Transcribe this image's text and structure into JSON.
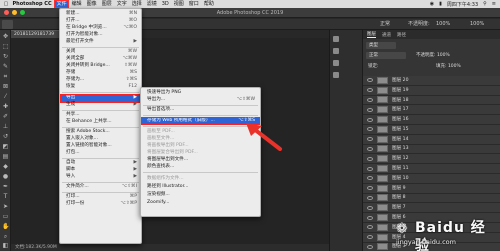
{
  "menubar": {
    "apple": "",
    "app": "Photoshop CC",
    "items": [
      "文件",
      "编辑",
      "图像",
      "图层",
      "文字",
      "选择",
      "滤镜",
      "3D",
      "视图",
      "窗口",
      "帮助"
    ],
    "active_index": 1,
    "clock": "周四下午4:33"
  },
  "titlebar": {
    "title": "Adobe Photoshop CC 2019"
  },
  "options": {
    "mode": "正常",
    "opacity_label": "不透明度:",
    "opacity": "100%",
    "zoom": "100%"
  },
  "document": {
    "tab_label": "20181129181739",
    "status": "文档:182.3K/5.90M"
  },
  "file_menu": {
    "items": [
      {
        "label": "新建...",
        "shortcut": "⌘N"
      },
      {
        "label": "打开...",
        "shortcut": "⌘O"
      },
      {
        "label": "在 Bridge 中浏览...",
        "shortcut": "⌥⌘O"
      },
      {
        "label": "打开为智能对象...",
        "shortcut": ""
      },
      {
        "label": "最近打开文件",
        "shortcut": "▶"
      },
      {
        "label": "关闭",
        "shortcut": "⌘W"
      },
      {
        "label": "关闭全部",
        "shortcut": "⌥⌘W"
      },
      {
        "label": "关闭并转到 Bridge...",
        "shortcut": "⇧⌘W"
      },
      {
        "label": "存储",
        "shortcut": "⌘S"
      },
      {
        "label": "存储为...",
        "shortcut": "⇧⌘S"
      },
      {
        "label": "恢复",
        "shortcut": "F12"
      },
      {
        "label": "导出",
        "shortcut": "▶"
      },
      {
        "label": "生成",
        "shortcut": "▶"
      },
      {
        "label": "共享...",
        "shortcut": ""
      },
      {
        "label": "在 Behance 上共享...",
        "shortcut": ""
      },
      {
        "label": "搜索 Adobe Stock...",
        "shortcut": ""
      },
      {
        "label": "置入嵌入对象...",
        "shortcut": ""
      },
      {
        "label": "置入链接的智能对象...",
        "shortcut": ""
      },
      {
        "label": "打包...",
        "shortcut": ""
      },
      {
        "label": "自动",
        "shortcut": "▶"
      },
      {
        "label": "脚本",
        "shortcut": "▶"
      },
      {
        "label": "导入",
        "shortcut": "▶"
      },
      {
        "label": "文件简介...",
        "shortcut": "⌥⇧⌘I"
      },
      {
        "label": "打印...",
        "shortcut": "⌘P"
      },
      {
        "label": "打印一份",
        "shortcut": "⌥⇧⌘P"
      }
    ]
  },
  "export_submenu": {
    "items": [
      {
        "label": "快速导出为 PNG",
        "shortcut": ""
      },
      {
        "label": "导出为...",
        "shortcut": "⌥⇧⌘W"
      },
      {
        "label": "导出首选项...",
        "shortcut": ""
      },
      {
        "label": "存储为 Web 所用格式（旧版）...",
        "shortcut": "⌥⇧⌘S"
      },
      {
        "label": "画板至 PDF...",
        "shortcut": ""
      },
      {
        "label": "画板至文件...",
        "shortcut": ""
      },
      {
        "label": "将画板导出到 PDF...",
        "shortcut": ""
      },
      {
        "label": "将图层复合导出到 PDF...",
        "shortcut": ""
      },
      {
        "label": "将图层导出到文件...",
        "shortcut": ""
      },
      {
        "label": "颜色查找表...",
        "shortcut": ""
      },
      {
        "label": "数据组作为文件...",
        "shortcut": ""
      },
      {
        "label": "路径到 Illustrator...",
        "shortcut": ""
      },
      {
        "label": "渲染视频...",
        "shortcut": ""
      },
      {
        "label": "Zoomify...",
        "shortcut": ""
      }
    ]
  },
  "panel": {
    "tabs": [
      "图层",
      "通道",
      "路径"
    ],
    "kind": "类型",
    "blend": "正常",
    "opacity": "不透明度: 100%",
    "lock": "锁定:",
    "fill": "填充: 100%",
    "layers": [
      "图层 20",
      "图层 19",
      "图层 18",
      "图层 17",
      "图层 16",
      "图层 15",
      "图层 14",
      "图层 13",
      "图层 12",
      "图层 11",
      "图层 10",
      "图层 9",
      "图层 8",
      "图层 7",
      "图层 6",
      "图层 5",
      "图层 4",
      "图层 3"
    ]
  },
  "watermark": {
    "brand": "Baidu 经验",
    "url": "jingyan.baidu.com"
  },
  "colors": {
    "accent": "#2f64d6",
    "highlight_border": "#ff2020",
    "arrow": "#e8322a"
  }
}
